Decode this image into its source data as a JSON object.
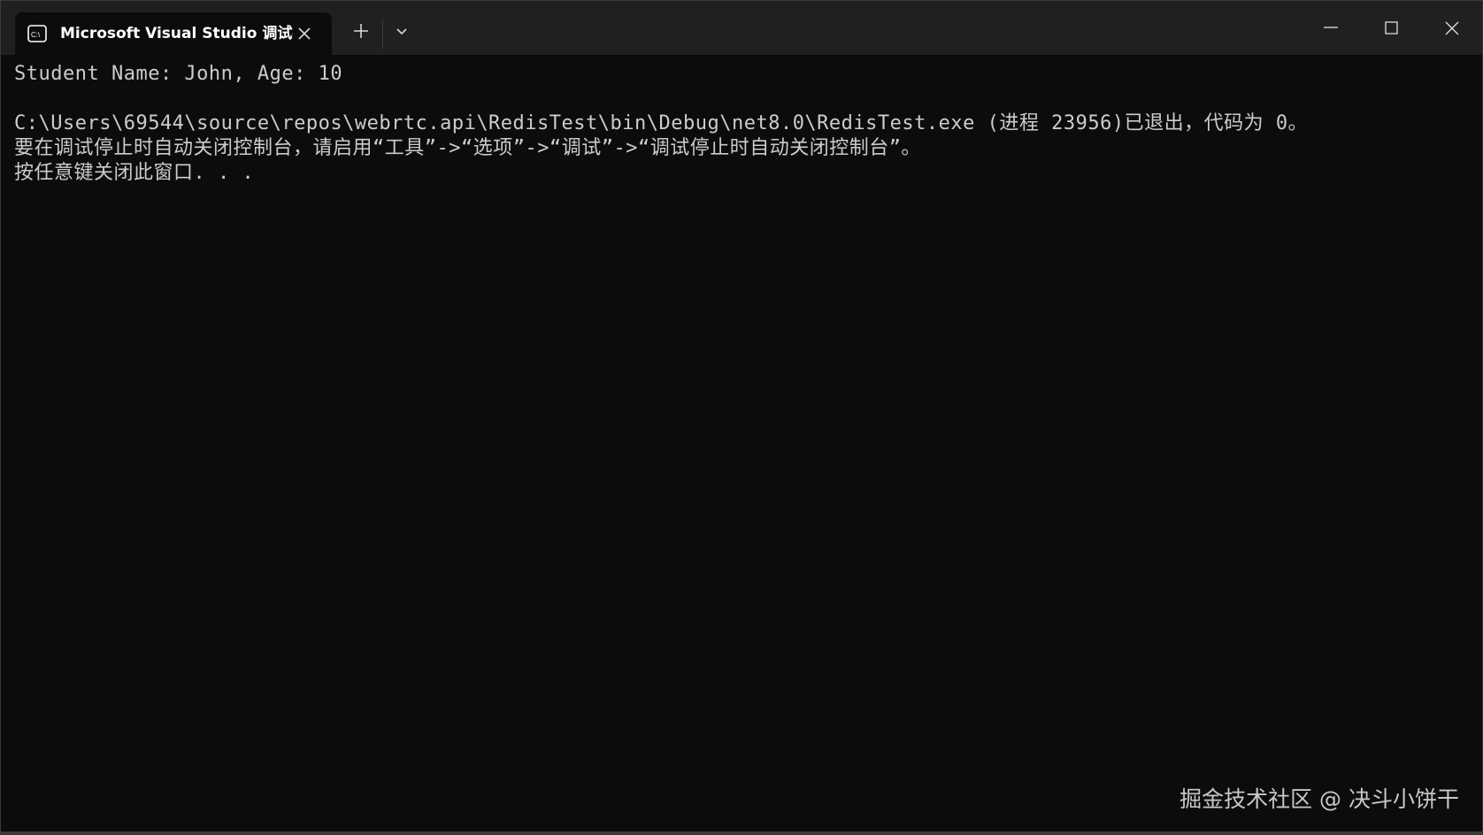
{
  "window": {
    "tab_title": "Microsoft Visual Studio 调试控制台",
    "tab_icon": "console-icon",
    "controls": {
      "new_tab_icon": "plus-icon",
      "dropdown_icon": "chevron-down-icon",
      "minimize_icon": "minimize-icon",
      "maximize_icon": "maximize-icon",
      "close_icon": "close-icon"
    }
  },
  "console": {
    "lines": [
      "Student Name: John, Age: 10",
      "",
      "C:\\Users\\69544\\source\\repos\\webrtc.api\\RedisTest\\bin\\Debug\\net8.0\\RedisTest.exe (进程 23956)已退出，代码为 0。",
      "要在调试停止时自动关闭控制台，请启用“工具”->“选项”->“调试”->“调试停止时自动关闭控制台”。",
      "按任意键关闭此窗口. . ."
    ]
  },
  "watermark": "掘金技术社区 @ 决斗小饼干",
  "colors": {
    "titlebar_bg": "#202020",
    "console_bg": "#0c0c0c",
    "console_text": "#cccccc"
  }
}
